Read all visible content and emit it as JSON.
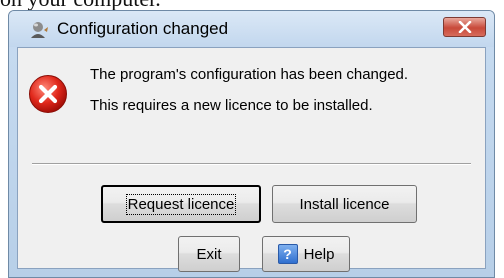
{
  "background": {
    "text": "on your computer."
  },
  "dialog": {
    "title": "Configuration changed",
    "message_line1": "The program's configuration has been changed.",
    "message_line2": "This requires a new licence to be installed.",
    "buttons": {
      "request": "Request licence",
      "install": "Install licence",
      "exit": "Exit",
      "help": "Help"
    },
    "icons": {
      "title": "app-icon",
      "error": "error-icon",
      "close": "close-icon",
      "help": "help-icon"
    },
    "colors": {
      "error_red": "#d7261b",
      "close_red": "#c8493a",
      "frame_blue": "#c8dcf1"
    }
  }
}
